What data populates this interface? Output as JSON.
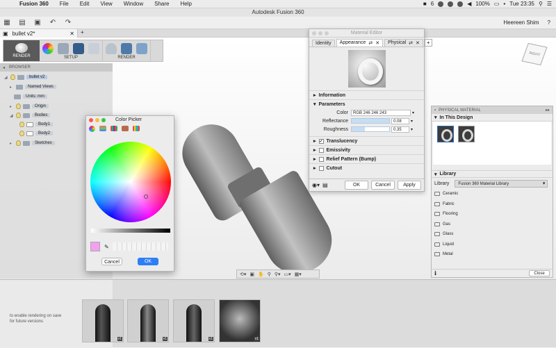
{
  "menubar": {
    "app": "Fusion 360",
    "items": [
      "File",
      "Edit",
      "View",
      "Window",
      "Share",
      "Help"
    ],
    "battery": "100%",
    "clock": "Tue 23:35",
    "badge": "6"
  },
  "window": {
    "title": "Autodesk Fusion 360"
  },
  "toolbar": {
    "user": "Heereen Shim",
    "help": "?"
  },
  "document": {
    "tab": "bullet v2*"
  },
  "ribbon": {
    "render_mode": "RENDER",
    "setup_label": "SETUP",
    "render_label": "RENDER"
  },
  "browser": {
    "header": "BROWSER",
    "items": [
      {
        "label": "bullet v2"
      },
      {
        "label": "Named Views"
      },
      {
        "label": "Units: mm"
      },
      {
        "label": "Origin"
      },
      {
        "label": "Bodies"
      },
      {
        "label": "Body1"
      },
      {
        "label": "Body2"
      },
      {
        "label": "Sketches"
      }
    ]
  },
  "viewcube": {
    "label": "RIGHT"
  },
  "material_editor": {
    "title": "Material Editor",
    "tabs": [
      "Identity",
      "Appearance",
      "Physical"
    ],
    "sections": [
      "Information",
      "Parameters",
      "Translucency",
      "Emissivity",
      "Relief Pattern (Bump)",
      "Cutout"
    ],
    "color_label": "Color",
    "color_value": "RGB 246 246 243",
    "reflectance_label": "Reflectance",
    "reflectance_value": "0.08",
    "roughness_label": "Roughness",
    "roughness_value": "0.35",
    "ok": "OK",
    "cancel": "Cancel",
    "apply": "Apply"
  },
  "color_picker": {
    "title": "Color Picker",
    "current_color": "#f59ff0",
    "cancel": "Cancel",
    "ok": "OK"
  },
  "physical_material": {
    "header": "PHYSICAL MATERIAL",
    "in_design": "In This Design",
    "library_section": "Library",
    "library_label": "Library",
    "library_value": "Fusion 360 Material Library",
    "categories": [
      "Ceramic",
      "Fabric",
      "Flooring",
      "Gas",
      "Glass",
      "Liquid",
      "Metal"
    ],
    "close": "Close"
  },
  "gallery": {
    "notice_line1": "to enable rendering on save",
    "notice_line2": "for future versions",
    "version_label": "v1"
  }
}
